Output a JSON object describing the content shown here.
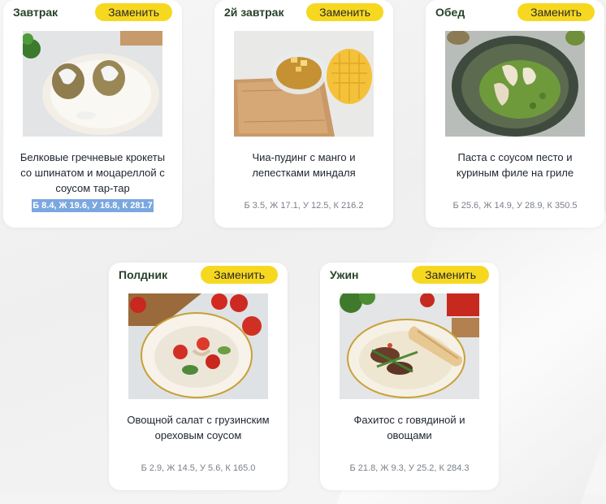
{
  "replace_label": "Заменить",
  "meals": [
    {
      "type": "Завтрак",
      "name_lines": [
        "Белковые гречневые крокеты",
        "со шпинатом и моцареллой с",
        "соусом тар-тар"
      ],
      "macros": "Б 8.4, Ж 19.6, У 16.8, К 281.7",
      "macros_selected": true,
      "photo_icon": "buckwheat-croquettes-photo"
    },
    {
      "type": "2й завтрак",
      "name_lines": [
        "Чиа-пудинг с манго и",
        "лепестками миндаля"
      ],
      "macros": "Б 3.5, Ж 17.1, У 12.5, К 216.2",
      "macros_selected": false,
      "photo_icon": "chia-pudding-mango-photo"
    },
    {
      "type": "Обед",
      "name_lines": [
        "Паста с соусом песто и",
        "куриным филе на гриле"
      ],
      "macros": "Б 25.6, Ж 14.9, У 28.9, К 350.5",
      "macros_selected": false,
      "photo_icon": "pesto-pasta-chicken-photo"
    },
    {
      "type": "Полдник",
      "name_lines": [
        "Овощной салат с грузинским",
        "ореховым соусом"
      ],
      "macros": "Б 2.9, Ж 14.5, У 5.6, К 165.0",
      "macros_selected": false,
      "photo_icon": "vegetable-salad-photo"
    },
    {
      "type": "Ужин",
      "name_lines": [
        "Фахитос с говядиной и",
        "овощами"
      ],
      "macros": "Б 21.8, Ж 9.3, У 25.2, К 284.3",
      "macros_selected": false,
      "photo_icon": "beef-fajitas-photo"
    }
  ],
  "colors": {
    "button_yellow": "#f7d820",
    "meal_type_green": "#27412a",
    "selection_blue": "#7ba7e0"
  }
}
